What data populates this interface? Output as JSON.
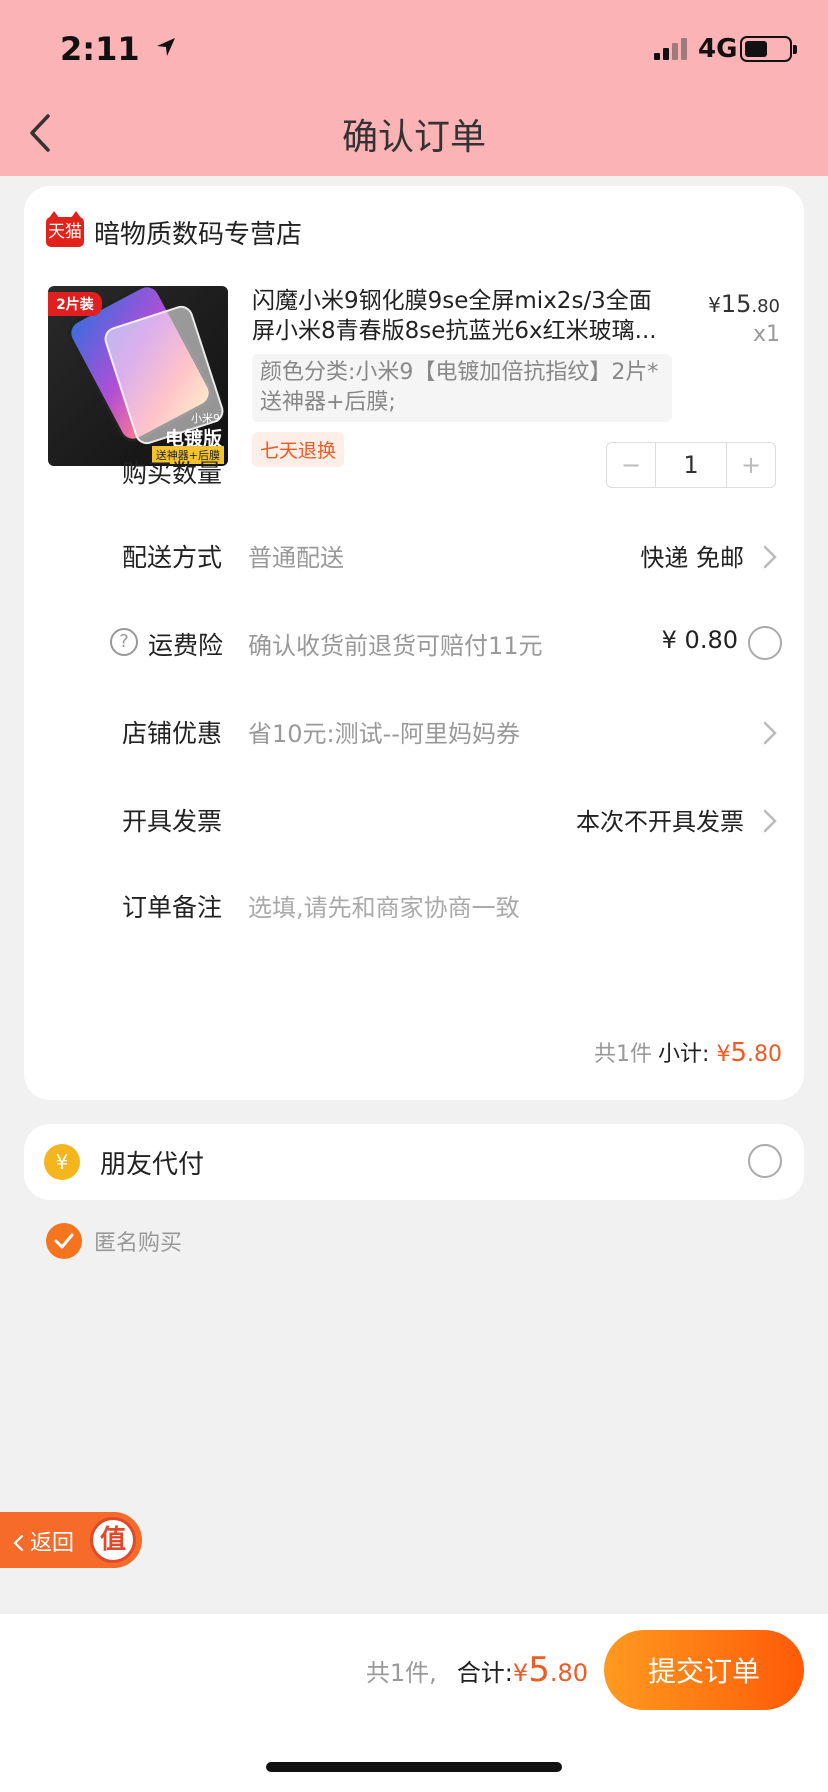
{
  "status_bar": {
    "time": "2:11",
    "network": "4G"
  },
  "header": {
    "title": "确认订单"
  },
  "shop": {
    "badge": "天猫",
    "name": "暗物质数码专营店"
  },
  "product": {
    "title": "闪魔小米9钢化膜9se全屏mix2s/3全面屏小米8青春版8se抗蓝光6x红米玻璃...",
    "spec": "颜色分类:小米9【电镀加倍抗指纹】2片*送神器+后膜;",
    "tag": "七天退换",
    "price_symbol": "¥",
    "price_int": "15",
    "price_dec": ".80",
    "quantity_label": "x1",
    "image": {
      "badge": "2片装",
      "model": "小米9",
      "edition": "电镀版",
      "gift": "送神器+后膜"
    }
  },
  "rows": {
    "quantity": {
      "label": "购买数量",
      "minus": "−",
      "value": "1",
      "plus": "+"
    },
    "delivery": {
      "label": "配送方式",
      "value": "普通配送",
      "right": "快递 免邮"
    },
    "insurance": {
      "label": "运费险",
      "help": "?",
      "value": "确认收货前退货可赔付11元",
      "right": "¥ 0.80"
    },
    "coupon": {
      "label": "店铺优惠",
      "value": "省10元:测试--阿里妈妈券"
    },
    "invoice": {
      "label": "开具发票",
      "right": "本次不开具发票"
    },
    "note": {
      "label": "订单备注",
      "placeholder": "选填,请先和商家协商一致"
    }
  },
  "subtotal": {
    "count": "共1件",
    "label": "小计:",
    "symbol": "¥",
    "int": "5",
    "dec": ".80"
  },
  "friend_pay": {
    "icon": "¥",
    "label": "朋友代付"
  },
  "anonymous": {
    "label": "匿名购买",
    "checked": true
  },
  "float_back": {
    "label": "返回",
    "seal": "值"
  },
  "footer": {
    "count": "共1件,",
    "label": "合计:",
    "symbol": "¥",
    "int": "5",
    "dec": ".80",
    "submit": "提交订单"
  },
  "colors": {
    "header_bg": "#fbb3b5",
    "accent": "#f05a24",
    "button_gradient": [
      "#ff9a1f",
      "#ff5a08"
    ]
  }
}
